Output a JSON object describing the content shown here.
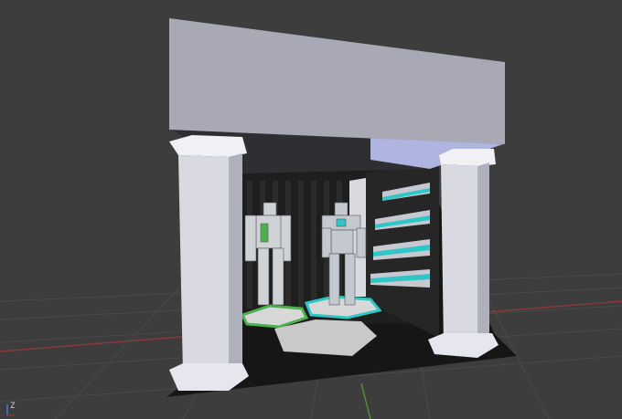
{
  "viewport": {
    "background": "#3d3d3d",
    "grid_color": "#4a4a4a",
    "x_axis_color": "#8a3a3a",
    "y_axis_color": "#5a8a3a"
  },
  "axis_gizmo": {
    "z_label": "Z"
  },
  "scene": {
    "description_objects": [
      "stage-floor",
      "back-wall",
      "side-wall-panels",
      "ceiling-beam",
      "left-pillar",
      "right-pillar",
      "robot-left",
      "robot-right",
      "hex-pad-left",
      "hex-pad-center",
      "hex-pad-front"
    ],
    "accent_color": "#2ec6c6",
    "pad_left_color": "#4caf50",
    "pad_center_color": "#2ec6c6"
  }
}
